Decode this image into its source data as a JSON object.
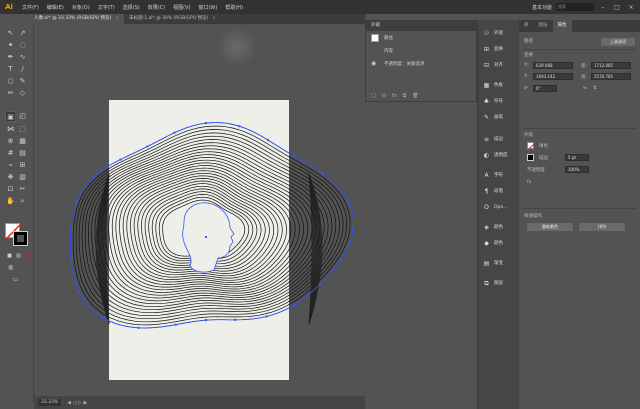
{
  "app": {
    "logo": "Ai"
  },
  "menu": [
    "文件(F)",
    "编辑(E)",
    "对象(O)",
    "文字(T)",
    "选择(S)",
    "效果(C)",
    "视图(V)",
    "窗口(W)",
    "帮助(H)"
  ],
  "workspace": "基本功能",
  "search_placeholder": "搜索",
  "tabs": [
    {
      "label": "人像.ai* @ 33.33% (RGB/GPU 预览)",
      "active": true
    },
    {
      "label": "未标题-1.ai* @ 30% (RGB/GPU 预览)",
      "active": false
    }
  ],
  "status": {
    "zoom": "33.33%"
  },
  "layers_panel": {
    "title": "外观",
    "row1": "路径",
    "row2": "内容",
    "row3": "不透明度：关联选项"
  },
  "panel_column": [
    "外观",
    "变换",
    "对齐",
    "色板",
    "符号",
    "画笔",
    "描边",
    "透明度",
    "字符",
    "段落",
    "Ope...",
    "颜色",
    "颜色",
    "渐变",
    "图层"
  ],
  "properties": {
    "tabs": [
      "库",
      "图层",
      "属性"
    ],
    "section_path": "路径",
    "transform_label": "变换",
    "x": "639.068",
    "y": "1693.142",
    "w": "1712.085",
    "h": "2576.785",
    "angle": "0°",
    "appearance_label": "外观",
    "fill_label": "填色",
    "stroke_label": "描边",
    "stroke_value": "5 pt",
    "opacity_label": "不透明度",
    "opacity_value": "100%",
    "quick_actions_label": "快速操作",
    "btn_offset": "重新着色",
    "btn_arrange": "排列",
    "btn_top": "上具选项"
  }
}
